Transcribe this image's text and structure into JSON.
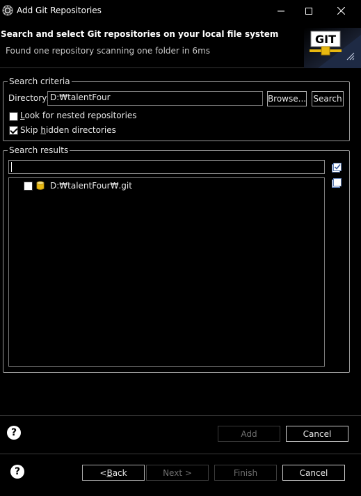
{
  "window": {
    "title": "Add Git Repositories"
  },
  "banner": {
    "title": "Search and select Git repositories on your local file system",
    "message": "Found one repository scanning one folder in 6ms",
    "logo_text": "GIT"
  },
  "search_criteria": {
    "group_label": "Search criteria",
    "directory_label": "Directory:",
    "directory_value": "D:₩talentFour",
    "browse_label": "Browse...",
    "search_label": "Search",
    "nested_label_mnemonic": "L",
    "nested_label_rest": "ook for nested repositories",
    "nested_checked": false,
    "skip_label_pre": "Skip ",
    "skip_label_mnemonic": "h",
    "skip_label_rest": "idden directories",
    "skip_checked": true
  },
  "search_results": {
    "group_label": "Search results",
    "filter_value": "",
    "items": [
      {
        "label": "D:₩talentFour₩.git",
        "checked": false
      }
    ]
  },
  "dialog_buttons": {
    "add": "Add",
    "cancel": "Cancel"
  },
  "wizard_buttons": {
    "back_pre": "< ",
    "back_mnemonic": "B",
    "back_rest": "ack",
    "next": "Next >",
    "finish": "Finish",
    "cancel": "Cancel"
  }
}
